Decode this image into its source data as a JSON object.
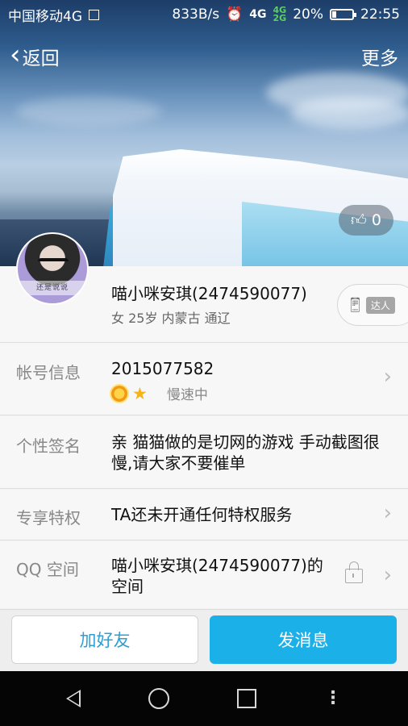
{
  "statusbar": {
    "carrier": "中国移动4G",
    "net_speed": "833B/s",
    "net_type": "4G",
    "signal_labels": [
      "4G",
      "2G"
    ],
    "battery": "20%",
    "battery_level": 0.2,
    "time": "22:55"
  },
  "nav": {
    "back_label": "返回",
    "more_label": "更多"
  },
  "cover": {
    "like_count": "0"
  },
  "profile": {
    "nickname": "喵小咪安琪(2474590077)",
    "meta": "女 25岁 内蒙古 通辽",
    "avatar_caption": "还是说说",
    "badge_label": "达人"
  },
  "rows": {
    "account": {
      "label": "帐号信息",
      "value": "2015077582",
      "speed": "慢速中"
    },
    "signature": {
      "label": "个性签名",
      "value": "亲 猫猫做的是切网的游戏  手动截图很慢,请大家不要催单"
    },
    "privilege": {
      "label": "专享特权",
      "value": "TA还未开通任何特权服务"
    },
    "qzone": {
      "label": "QQ 空间",
      "value": "喵小咪安琪(2474590077)的空间"
    }
  },
  "actions": {
    "add_friend": "加好友",
    "send_message": "发消息"
  },
  "colors": {
    "accent": "#1cb0e8",
    "accent_text": "#2b9fd6"
  }
}
